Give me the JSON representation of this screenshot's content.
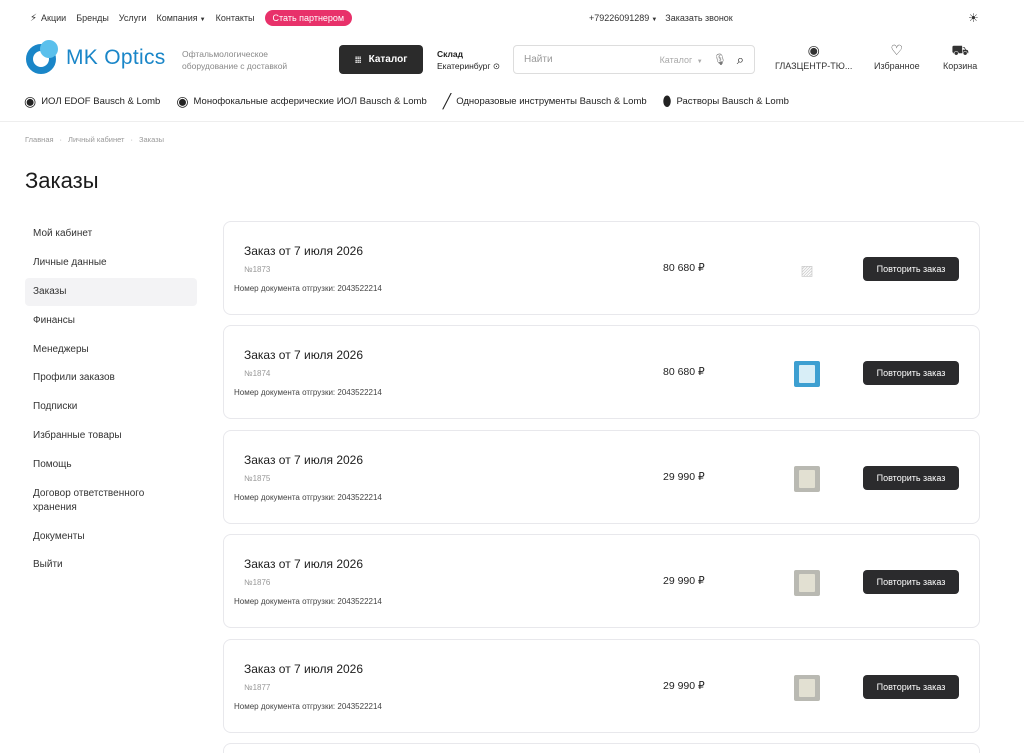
{
  "topbar": {
    "nav": [
      "Акции",
      "Бренды",
      "Услуги",
      "Компания",
      "Контакты"
    ],
    "partner_label": "Стать партнером",
    "phone": "+79226091289",
    "callback": "Заказать звонок"
  },
  "header": {
    "logo_text": "MK Optics",
    "tagline": "Офтальмологическое оборудование с доставкой",
    "catalog_label": "Каталог",
    "warehouse_title": "Склад",
    "warehouse_city": "Екатеринбург",
    "search_placeholder": "Найти",
    "search_scope": "Каталог",
    "account_label": "ГЛАЗЦЕНТР-ТЮ...",
    "favorites_label": "Избранное",
    "cart_label": "Корзина"
  },
  "categories": [
    "ИОЛ EDOF Bausch & Lomb",
    "Монофокальные асферические ИОЛ Bausch & Lomb",
    "Одноразовые инструменты Bausch & Lomb",
    "Растворы Bausch & Lomb"
  ],
  "breadcrumb": [
    "Главная",
    "Личный кабинет",
    "Заказы"
  ],
  "page_title": "Заказы",
  "sidebar": [
    "Мой кабинет",
    "Личные данные",
    "Заказы",
    "Финансы",
    "Менеджеры",
    "Профили заказов",
    "Подписки",
    "Избранные товары",
    "Помощь",
    "Договор ответственного хранения",
    "Документы",
    "Выйти"
  ],
  "orders": [
    {
      "title": "Заказ от 7 июля 2026",
      "number": "№1873",
      "doc": "Номер документа отгрузки: 2043522214",
      "sum": "80 680 ₽",
      "repeat": "Повторить заказ"
    },
    {
      "title": "Заказ от 7 июля 2026",
      "number": "№1874",
      "doc": "Номер документа отгрузки: 2043522214",
      "sum": "80 680 ₽",
      "repeat": "Повторить заказ"
    },
    {
      "title": "Заказ от 7 июля 2026",
      "number": "№1875",
      "doc": "Номер документа отгрузки: 2043522214",
      "sum": "29 990 ₽",
      "repeat": "Повторить заказ"
    },
    {
      "title": "Заказ от 7 июля 2026",
      "number": "№1876",
      "doc": "Номер документа отгрузки: 2043522214",
      "sum": "29 990 ₽",
      "repeat": "Повторить заказ"
    },
    {
      "title": "Заказ от 7 июля 2026",
      "number": "№1877",
      "doc": "Номер документа отгрузки: 2043522214",
      "sum": "29 990 ₽",
      "repeat": "Повторить заказ"
    }
  ],
  "colors": {
    "brand": "#1a86c8",
    "partner": "#e8316a",
    "dark_button": "#2b2b2d"
  }
}
